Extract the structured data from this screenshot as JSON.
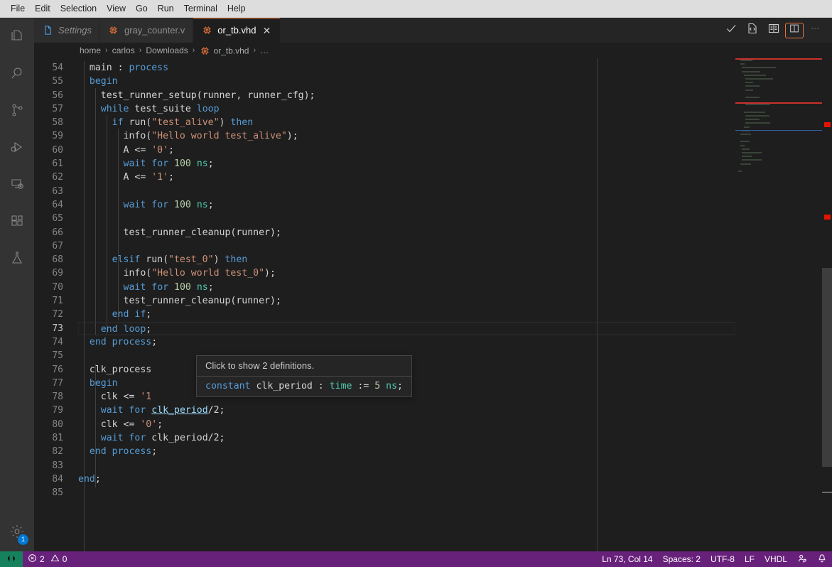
{
  "menubar": {
    "items": [
      "File",
      "Edit",
      "Selection",
      "View",
      "Go",
      "Run",
      "Terminal",
      "Help"
    ]
  },
  "activitybar": {
    "items": [
      {
        "name": "explorer",
        "icon": "files-icon",
        "title": "Explorer"
      },
      {
        "name": "search",
        "icon": "search-icon",
        "title": "Search"
      },
      {
        "name": "source-control",
        "icon": "source-control-icon",
        "title": "Source Control"
      },
      {
        "name": "run-debug",
        "icon": "run-and-debug-icon",
        "title": "Run and Debug"
      },
      {
        "name": "remote-explorer",
        "icon": "remote-explorer-icon",
        "title": "Remote Explorer"
      },
      {
        "name": "extensions",
        "icon": "extensions-icon",
        "title": "Extensions"
      },
      {
        "name": "testing",
        "icon": "beaker-icon",
        "title": "Testing"
      }
    ],
    "manage": {
      "icon": "gear-icon",
      "title": "Manage",
      "badge": "1"
    }
  },
  "tabs": [
    {
      "label": "Settings",
      "icon": "file-icon",
      "active": false,
      "italic": true,
      "closable": false
    },
    {
      "label": "gray_counter.v",
      "icon": "chip-icon",
      "active": false,
      "italic": false,
      "closable": false
    },
    {
      "label": "or_tb.vhd",
      "icon": "chip-icon",
      "active": true,
      "italic": false,
      "closable": true,
      "close_label": "✕"
    }
  ],
  "editor_actions": [
    {
      "name": "run-check-button",
      "icon": "checkmark-icon"
    },
    {
      "name": "open-source-button",
      "icon": "code-file-icon"
    },
    {
      "name": "open-preview-button",
      "icon": "book-icon"
    },
    {
      "name": "split-editor-button",
      "icon": "split-editor-icon"
    },
    {
      "name": "more-actions-button",
      "icon": "ellipsis-icon"
    }
  ],
  "breadcrumbs": {
    "separator": "›",
    "items": [
      {
        "label": "home",
        "icon": null
      },
      {
        "label": "carlos",
        "icon": null
      },
      {
        "label": "Downloads",
        "icon": null
      },
      {
        "label": "or_tb.vhd",
        "icon": "chip-icon"
      },
      {
        "label": "…",
        "icon": null
      }
    ]
  },
  "editor": {
    "first_line_number": 54,
    "current_line": 73,
    "lines": [
      {
        "n": 54,
        "tokens": [
          {
            "t": "  ",
            "c": "pl"
          },
          {
            "t": "main",
            "c": "pl"
          },
          {
            "t": " : ",
            "c": "pl"
          },
          {
            "t": "process",
            "c": "kw"
          }
        ]
      },
      {
        "n": 55,
        "tokens": [
          {
            "t": "  ",
            "c": "pl"
          },
          {
            "t": "begin",
            "c": "kw"
          }
        ]
      },
      {
        "n": 56,
        "tokens": [
          {
            "t": "    ",
            "c": "pl"
          },
          {
            "t": "test_runner_setup",
            "c": "pl"
          },
          {
            "t": "(runner, runner_cfg);",
            "c": "pl"
          }
        ]
      },
      {
        "n": 57,
        "tokens": [
          {
            "t": "    ",
            "c": "pl"
          },
          {
            "t": "while",
            "c": "kw"
          },
          {
            "t": " test_suite ",
            "c": "pl"
          },
          {
            "t": "loop",
            "c": "kw"
          }
        ]
      },
      {
        "n": 58,
        "tokens": [
          {
            "t": "      ",
            "c": "pl"
          },
          {
            "t": "if",
            "c": "kw"
          },
          {
            "t": " run(",
            "c": "pl"
          },
          {
            "t": "\"test_alive\"",
            "c": "str"
          },
          {
            "t": ") ",
            "c": "pl"
          },
          {
            "t": "then",
            "c": "kw"
          }
        ]
      },
      {
        "n": 59,
        "tokens": [
          {
            "t": "        ",
            "c": "pl"
          },
          {
            "t": "info(",
            "c": "pl"
          },
          {
            "t": "\"Hello world test_alive\"",
            "c": "str"
          },
          {
            "t": ");",
            "c": "pl"
          }
        ]
      },
      {
        "n": 60,
        "tokens": [
          {
            "t": "        ",
            "c": "pl"
          },
          {
            "t": "A <= ",
            "c": "pl"
          },
          {
            "t": "'0'",
            "c": "str"
          },
          {
            "t": ";",
            "c": "pl"
          }
        ]
      },
      {
        "n": 61,
        "tokens": [
          {
            "t": "        ",
            "c": "pl"
          },
          {
            "t": "wait",
            "c": "kw"
          },
          {
            "t": " ",
            "c": "pl"
          },
          {
            "t": "for",
            "c": "kw"
          },
          {
            "t": " ",
            "c": "pl"
          },
          {
            "t": "100",
            "c": "num"
          },
          {
            "t": " ",
            "c": "pl"
          },
          {
            "t": "ns",
            "c": "typ"
          },
          {
            "t": ";",
            "c": "pl"
          }
        ]
      },
      {
        "n": 62,
        "tokens": [
          {
            "t": "        ",
            "c": "pl"
          },
          {
            "t": "A <= ",
            "c": "pl"
          },
          {
            "t": "'1'",
            "c": "str"
          },
          {
            "t": ";",
            "c": "pl"
          }
        ]
      },
      {
        "n": 63,
        "tokens": []
      },
      {
        "n": 64,
        "tokens": [
          {
            "t": "        ",
            "c": "pl"
          },
          {
            "t": "wait",
            "c": "kw"
          },
          {
            "t": " ",
            "c": "pl"
          },
          {
            "t": "for",
            "c": "kw"
          },
          {
            "t": " ",
            "c": "pl"
          },
          {
            "t": "100",
            "c": "num"
          },
          {
            "t": " ",
            "c": "pl"
          },
          {
            "t": "ns",
            "c": "typ"
          },
          {
            "t": ";",
            "c": "pl"
          }
        ]
      },
      {
        "n": 65,
        "tokens": []
      },
      {
        "n": 66,
        "tokens": [
          {
            "t": "        ",
            "c": "pl"
          },
          {
            "t": "test_runner_cleanup(runner);",
            "c": "pl"
          }
        ]
      },
      {
        "n": 67,
        "tokens": []
      },
      {
        "n": 68,
        "tokens": [
          {
            "t": "      ",
            "c": "pl"
          },
          {
            "t": "elsif",
            "c": "kw"
          },
          {
            "t": " run(",
            "c": "pl"
          },
          {
            "t": "\"test_0\"",
            "c": "str"
          },
          {
            "t": ") ",
            "c": "pl"
          },
          {
            "t": "then",
            "c": "kw"
          }
        ]
      },
      {
        "n": 69,
        "tokens": [
          {
            "t": "        ",
            "c": "pl"
          },
          {
            "t": "info(",
            "c": "pl"
          },
          {
            "t": "\"Hello world test_0\"",
            "c": "str"
          },
          {
            "t": ");",
            "c": "pl"
          }
        ]
      },
      {
        "n": 70,
        "tokens": [
          {
            "t": "        ",
            "c": "pl"
          },
          {
            "t": "wait",
            "c": "kw"
          },
          {
            "t": " ",
            "c": "pl"
          },
          {
            "t": "for",
            "c": "kw"
          },
          {
            "t": " ",
            "c": "pl"
          },
          {
            "t": "100",
            "c": "num"
          },
          {
            "t": " ",
            "c": "pl"
          },
          {
            "t": "ns",
            "c": "typ"
          },
          {
            "t": ";",
            "c": "pl"
          }
        ]
      },
      {
        "n": 71,
        "tokens": [
          {
            "t": "        ",
            "c": "pl"
          },
          {
            "t": "test_runner_cleanup(runner);",
            "c": "pl"
          }
        ]
      },
      {
        "n": 72,
        "tokens": [
          {
            "t": "      ",
            "c": "pl"
          },
          {
            "t": "end if",
            "c": "kw"
          },
          {
            "t": ";",
            "c": "pl"
          }
        ]
      },
      {
        "n": 73,
        "tokens": [
          {
            "t": "    ",
            "c": "pl"
          },
          {
            "t": "end loop",
            "c": "kw"
          },
          {
            "t": ";",
            "c": "pl"
          }
        ]
      },
      {
        "n": 74,
        "tokens": [
          {
            "t": "  ",
            "c": "pl"
          },
          {
            "t": "end",
            "c": "kw"
          },
          {
            "t": " ",
            "c": "pl"
          },
          {
            "t": "process",
            "c": "kw"
          },
          {
            "t": ";",
            "c": "pl"
          }
        ]
      },
      {
        "n": 75,
        "tokens": []
      },
      {
        "n": 76,
        "tokens": [
          {
            "t": "  ",
            "c": "pl"
          },
          {
            "t": "clk_process",
            "c": "pl"
          }
        ]
      },
      {
        "n": 77,
        "tokens": [
          {
            "t": "  ",
            "c": "pl"
          },
          {
            "t": "begin",
            "c": "kw"
          }
        ]
      },
      {
        "n": 78,
        "tokens": [
          {
            "t": "    ",
            "c": "pl"
          },
          {
            "t": "clk <= ",
            "c": "pl"
          },
          {
            "t": "'1",
            "c": "str"
          }
        ]
      },
      {
        "n": 79,
        "tokens": [
          {
            "t": "    ",
            "c": "pl"
          },
          {
            "t": "wait",
            "c": "kw"
          },
          {
            "t": " ",
            "c": "pl"
          },
          {
            "t": "for",
            "c": "kw"
          },
          {
            "t": " ",
            "c": "pl"
          },
          {
            "t": "clk_period",
            "c": "lnk"
          },
          {
            "t": "/2;",
            "c": "pl"
          }
        ]
      },
      {
        "n": 80,
        "tokens": [
          {
            "t": "    ",
            "c": "pl"
          },
          {
            "t": "clk <= ",
            "c": "pl"
          },
          {
            "t": "'0'",
            "c": "str"
          },
          {
            "t": ";",
            "c": "pl"
          }
        ]
      },
      {
        "n": 81,
        "tokens": [
          {
            "t": "    ",
            "c": "pl"
          },
          {
            "t": "wait",
            "c": "kw"
          },
          {
            "t": " ",
            "c": "pl"
          },
          {
            "t": "for",
            "c": "kw"
          },
          {
            "t": " clk_period/2;",
            "c": "pl"
          }
        ]
      },
      {
        "n": 82,
        "tokens": [
          {
            "t": "  ",
            "c": "pl"
          },
          {
            "t": "end",
            "c": "kw"
          },
          {
            "t": " ",
            "c": "pl"
          },
          {
            "t": "process",
            "c": "kw"
          },
          {
            "t": ";",
            "c": "pl"
          }
        ]
      },
      {
        "n": 83,
        "tokens": []
      },
      {
        "n": 84,
        "tokens": [
          {
            "t": "end",
            "c": "kw"
          },
          {
            "t": ";",
            "c": "pl"
          }
        ]
      },
      {
        "n": 85,
        "tokens": []
      }
    ]
  },
  "hover": {
    "title": "Click to show 2 definitions.",
    "signature": [
      {
        "t": "constant",
        "c": "kw"
      },
      {
        "t": " clk_period : ",
        "c": "pl"
      },
      {
        "t": "time",
        "c": "typ"
      },
      {
        "t": " := ",
        "c": "pl"
      },
      {
        "t": "5",
        "c": "num"
      },
      {
        "t": " ",
        "c": "pl"
      },
      {
        "t": "ns",
        "c": "typ"
      },
      {
        "t": ";",
        "c": "pl"
      }
    ]
  },
  "statusbar": {
    "remote_icon": "remote-indicator-icon",
    "errors": "2",
    "warnings": "0",
    "error_icon": "error-circle-icon",
    "warning_icon": "warning-triangle-icon",
    "cursor_position": "Ln 73, Col 14",
    "indentation": "Spaces: 2",
    "encoding": "UTF-8",
    "eol": "LF",
    "language": "VHDL",
    "feedback_icon": "feedback-person-icon",
    "notifications_icon": "bell-icon"
  },
  "colors": {
    "accent_orange": "#e8743b",
    "statusbar_purple": "#68217a",
    "remote_green": "#16825d",
    "badge_blue": "#0078d4",
    "error_red": "#e51400"
  }
}
